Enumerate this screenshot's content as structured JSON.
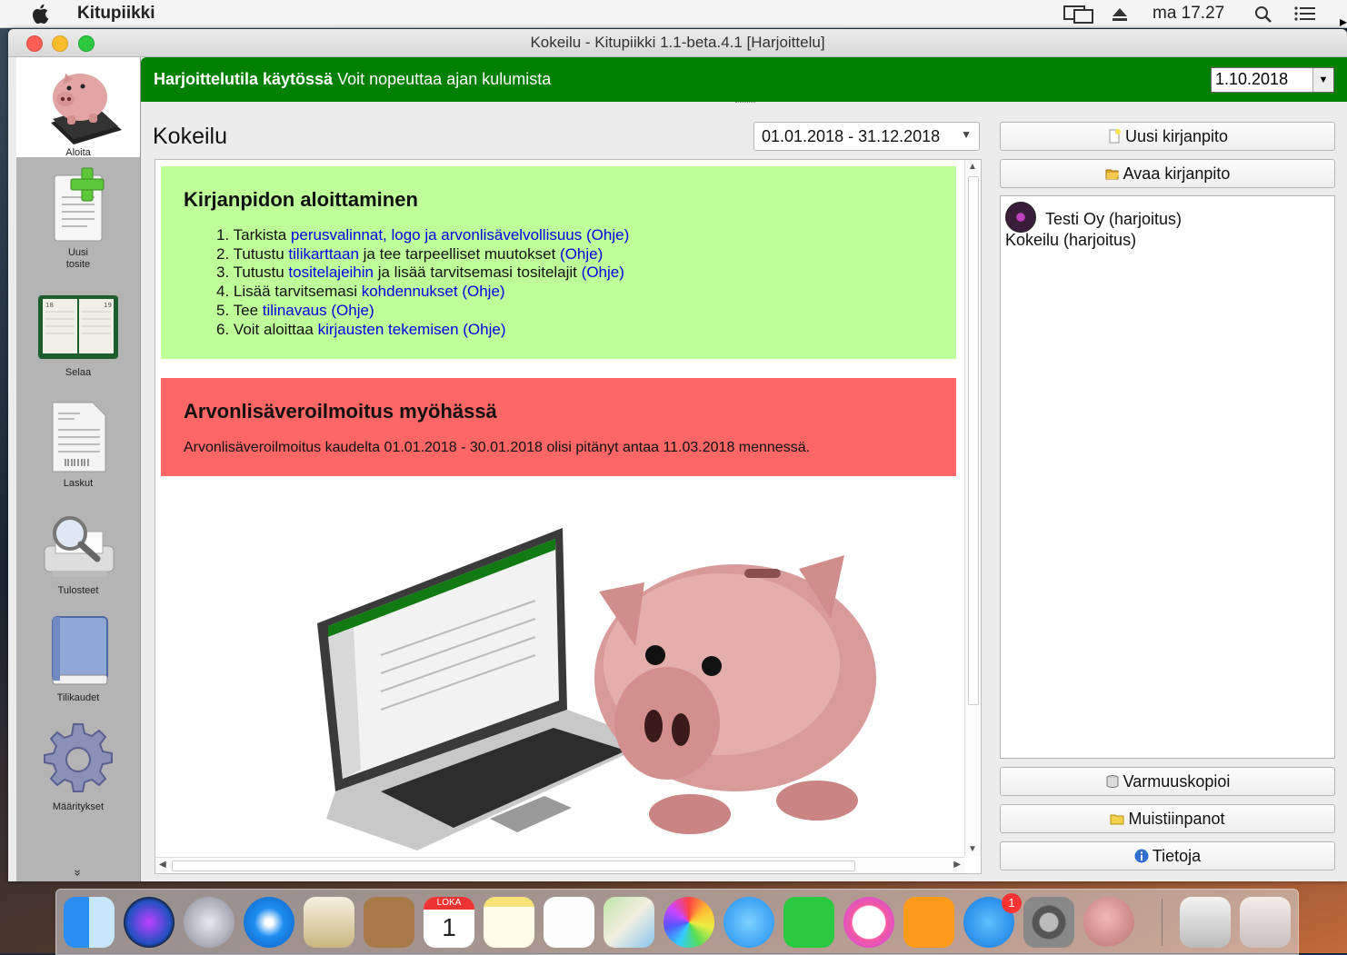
{
  "menubar": {
    "apple": "",
    "app_name": "Kitupiikki",
    "clock": "ma 17.27"
  },
  "window": {
    "title": "Kokeilu - Kitupiikki 1.1-beta.4.1 [Harjoittelu]"
  },
  "sidebar": {
    "items": [
      {
        "label": "Aloita",
        "icon": "piggy-bank-icon",
        "active": true
      },
      {
        "label": "Uusi tosite",
        "icon": "new-document-icon"
      },
      {
        "label": "Selaa",
        "icon": "ledger-book-icon"
      },
      {
        "label": "Laskut",
        "icon": "invoice-icon"
      },
      {
        "label": "Tulosteet",
        "icon": "print-preview-icon"
      },
      {
        "label": "Tilikaudet",
        "icon": "book-icon"
      },
      {
        "label": "Määritykset",
        "icon": "gear-icon"
      }
    ],
    "more": "»"
  },
  "banner": {
    "bold": "Harjoittelutila käytössä",
    "text": "Voit nopeuttaa ajan kulumista",
    "date": "1.10.2018"
  },
  "main": {
    "title": "Kokeilu",
    "period": "01.01.2018 - 31.12.2018",
    "start_card": {
      "title": "Kirjanpidon aloittaminen",
      "steps": [
        {
          "num": "1.",
          "pre": "Tarkista",
          "link": "perusvalinnat, logo ja arvonlisävelvollisuus",
          "mid": "",
          "help": "(Ohje)"
        },
        {
          "num": "2.",
          "pre": "Tutustu",
          "link": "tilikarttaan",
          "mid": "ja tee tarpeelliset muutokset",
          "help": "(Ohje)"
        },
        {
          "num": "3.",
          "pre": "Tutustu",
          "link": "tositelajeihin",
          "mid": "ja lisää tarvitsemasi tositelajit",
          "help": "(Ohje)"
        },
        {
          "num": "4.",
          "pre": "Lisää tarvitsemasi",
          "link": "kohdennukset",
          "mid": "",
          "help": "(Ohje)"
        },
        {
          "num": "5.",
          "pre": "Tee",
          "link": "tilinavaus",
          "mid": "",
          "help": "(Ohje)"
        },
        {
          "num": "6.",
          "pre": "Voit aloittaa",
          "link": "kirjausten tekemisen",
          "mid": "",
          "help": "(Ohje)"
        }
      ]
    },
    "vat_card": {
      "title": "Arvonlisäveroilmoitus myöhässä",
      "text": "Arvonlisäveroilmoitus kaudelta 01.01.2018 - 30.01.2018 olisi pitänyt antaa 11.03.2018 mennessä."
    }
  },
  "right": {
    "new_button": "Uusi kirjanpito",
    "open_button": "Avaa kirjanpito",
    "recent": [
      {
        "company": "Testi Oy (harjoitus)"
      },
      {
        "name": "Kokeilu (harjoitus)"
      }
    ],
    "backup_button": "Varmuuskopioi",
    "notes_button": "Muistiinpanot",
    "info_button": "Tietoja"
  },
  "dock": {
    "calendar_month": "LOKA",
    "calendar_day": "1",
    "appstore_badge": "1",
    "apps": [
      "finder-icon",
      "siri-icon",
      "launchpad-icon",
      "safari-icon",
      "mail-icon",
      "contacts-icon",
      "calendar-icon",
      "notes-icon",
      "reminders-icon",
      "maps-icon",
      "photos-icon",
      "messages-icon",
      "facetime-icon",
      "itunes-icon",
      "ibooks-icon",
      "appstore-icon",
      "system-preferences-icon",
      "kitupiikki-icon",
      "downloads-icon",
      "trash-icon"
    ]
  }
}
